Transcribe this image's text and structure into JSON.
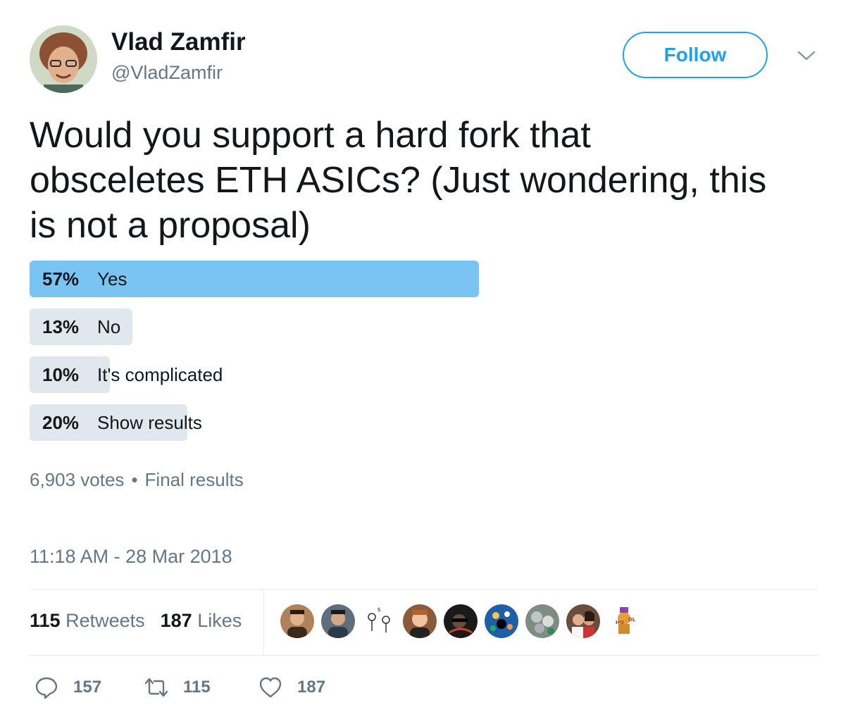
{
  "author": {
    "name": "Vlad Zamfir",
    "handle": "@VladZamfir",
    "avatar_icon": "user-avatar"
  },
  "follow_label": "Follow",
  "menu_icon": "chevron-down-icon",
  "tweet_lines": [
    "Would you support a hard fork that",
    "obsceletes ETH ASICs? (Just wondering, this",
    "is not a proposal)"
  ],
  "poll": {
    "options": [
      {
        "pct": "57%",
        "label": "Yes",
        "fraction": 0.57,
        "winner": true
      },
      {
        "pct": "13%",
        "label": "No",
        "fraction": 0.13,
        "winner": false
      },
      {
        "pct": "10%",
        "label": "It's complicated",
        "fraction": 0.1,
        "winner": false
      },
      {
        "pct": "20%",
        "label": "Show results",
        "fraction": 0.2,
        "winner": false
      }
    ],
    "votes": "6,903 votes",
    "separator": "•",
    "status": "Final results"
  },
  "timestamp": "11:18 AM - 28 Mar 2018",
  "stats": {
    "retweets_count": "115",
    "retweets_label": "Retweets",
    "likes_count": "187",
    "likes_label": "Likes"
  },
  "likers": [
    {
      "icon": "liker-avatar-1",
      "bg": "#b0825a"
    },
    {
      "icon": "liker-avatar-2",
      "bg": "#5f6e7d"
    },
    {
      "icon": "liker-avatar-3",
      "bg": "#ffffff"
    },
    {
      "icon": "liker-avatar-4",
      "bg": "#8a5a3a"
    },
    {
      "icon": "liker-avatar-5",
      "bg": "#1a1a1a"
    },
    {
      "icon": "liker-avatar-6",
      "bg": "#1f5fa8"
    },
    {
      "icon": "liker-avatar-7",
      "bg": "#7f8c84"
    },
    {
      "icon": "liker-avatar-8",
      "bg": "#6a4e3b"
    },
    {
      "icon": "liker-avatar-9",
      "bg": "#ffffff"
    }
  ],
  "actions": {
    "replies": "157",
    "retweets": "115",
    "likes": "187"
  },
  "colors": {
    "accent": "#1da1f2",
    "winner_bar": "#79c4f2",
    "bar": "#e1e8ed",
    "secondary_text": "#657786"
  }
}
